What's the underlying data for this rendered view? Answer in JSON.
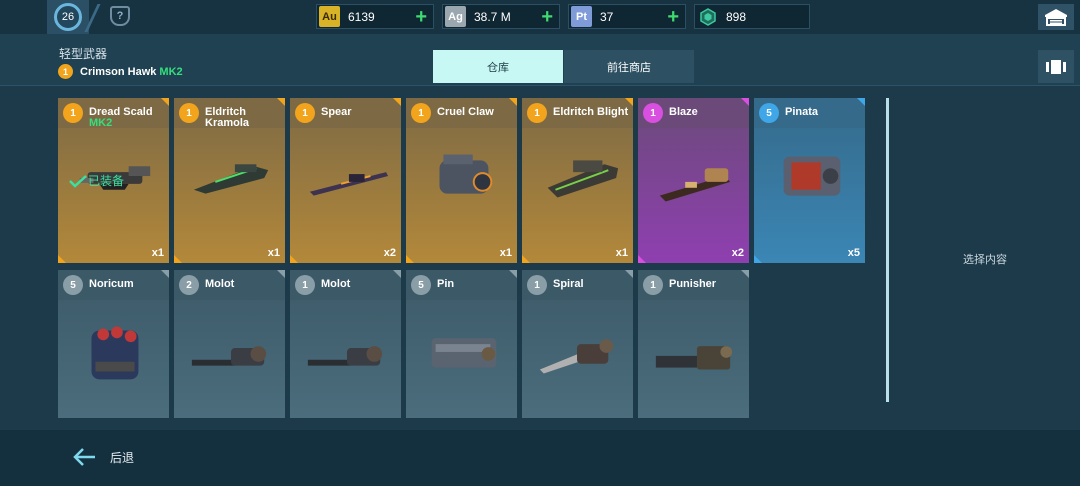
{
  "topbar": {
    "level": "26",
    "currencies": [
      {
        "tag": "Au",
        "value": "6139",
        "tag_color": "#d8b327",
        "icon": "gold-icon"
      },
      {
        "tag": "Ag",
        "value": "38.7 M",
        "tag_color": "#9aa7ae",
        "icon": "silver-icon"
      },
      {
        "tag": "Pt",
        "value": "37",
        "tag_color": "#7f9bd8",
        "icon": "platinum-icon"
      },
      {
        "tag": "",
        "value": "898",
        "tag_color": "#3cc9a4",
        "icon": "gem-icon"
      }
    ]
  },
  "header": {
    "category": "轻型武器",
    "weapon_level": "1",
    "weapon_name": "Crimson Hawk",
    "weapon_mk": "MK2"
  },
  "tabs": {
    "warehouse": "仓库",
    "shop": "前往商店"
  },
  "equipped_label": "已装备",
  "items": [
    {
      "level": "1",
      "name": "Dread Scald",
      "sub": "MK2",
      "qty": "x1",
      "rarity": "orange"
    },
    {
      "level": "1",
      "name": "Eldritch Kramola",
      "sub": "",
      "qty": "x1",
      "rarity": "orange"
    },
    {
      "level": "1",
      "name": "Spear",
      "sub": "",
      "qty": "x2",
      "rarity": "orange"
    },
    {
      "level": "1",
      "name": "Cruel Claw",
      "sub": "",
      "qty": "x1",
      "rarity": "orange"
    },
    {
      "level": "1",
      "name": "Eldritch Blight",
      "sub": "",
      "qty": "x1",
      "rarity": "orange"
    },
    {
      "level": "1",
      "name": "Blaze",
      "sub": "",
      "qty": "x2",
      "rarity": "purple"
    },
    {
      "level": "5",
      "name": "Pinata",
      "sub": "",
      "qty": "x5",
      "rarity": "blue"
    },
    {
      "level": "5",
      "name": "Noricum",
      "sub": "",
      "qty": "",
      "rarity": "gray"
    },
    {
      "level": "2",
      "name": "Molot",
      "sub": "",
      "qty": "",
      "rarity": "gray"
    },
    {
      "level": "1",
      "name": "Molot",
      "sub": "",
      "qty": "",
      "rarity": "gray"
    },
    {
      "level": "5",
      "name": "Pin",
      "sub": "",
      "qty": "",
      "rarity": "gray"
    },
    {
      "level": "1",
      "name": "Spiral",
      "sub": "",
      "qty": "",
      "rarity": "gray"
    },
    {
      "level": "1",
      "name": "Punisher",
      "sub": "",
      "qty": "",
      "rarity": "gray"
    }
  ],
  "rarity_colors": {
    "orange": {
      "bg": "#b3883a",
      "head": "#7d6a45",
      "badge": "#f2a41c",
      "corner": "#f2a41c"
    },
    "purple": {
      "bg": "#8f3fb0",
      "head": "#6b4a7a",
      "badge": "#d94fe0",
      "corner": "#d94fe0"
    },
    "blue": {
      "bg": "#3b86b5",
      "head": "#356a8a",
      "badge": "#3fa6e8",
      "corner": "#3fa6e8"
    },
    "gray": {
      "bg": "#4b6d7c",
      "head": "#3c5968",
      "badge": "#8a9ea8",
      "corner": "#8a9ea8"
    }
  },
  "side_panel": {
    "placeholder": "选择内容"
  },
  "footer": {
    "back_label": "后退"
  }
}
